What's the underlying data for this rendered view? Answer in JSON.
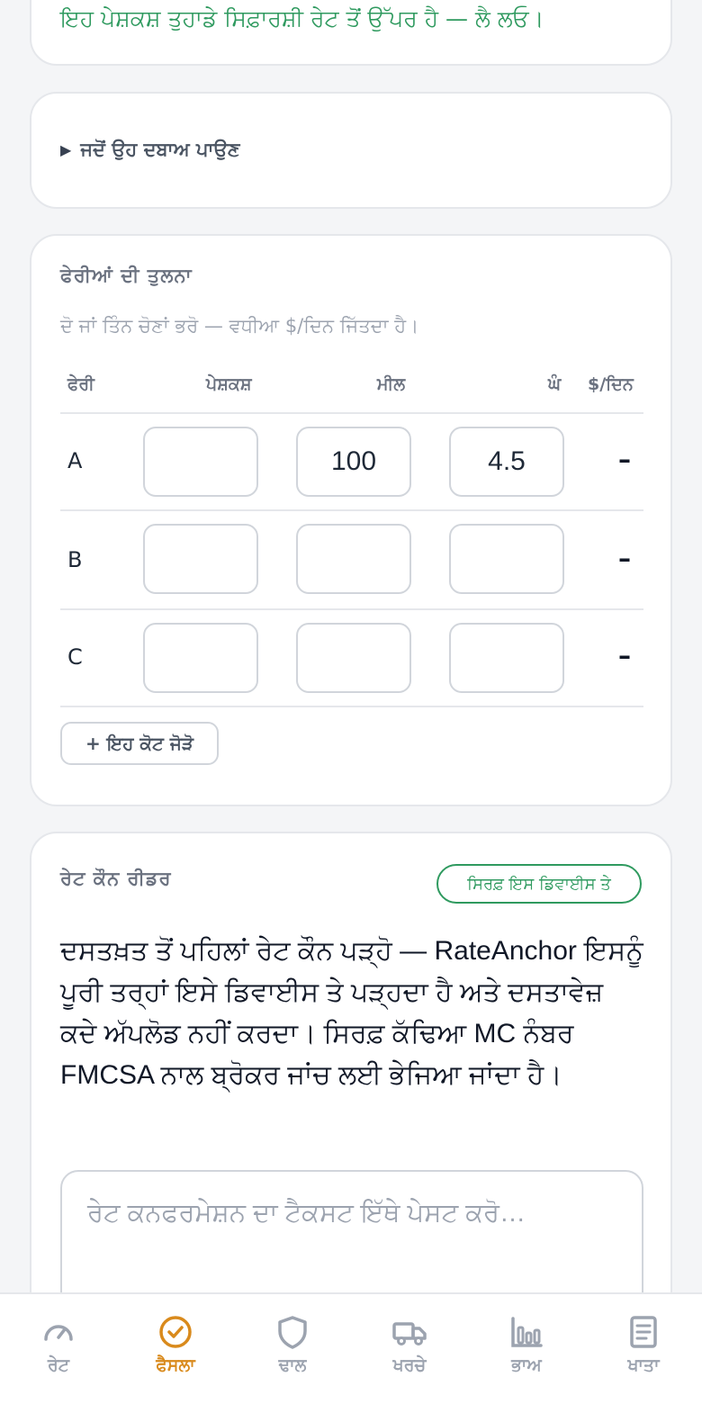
{
  "offer_verdict": {
    "accept_text": "ਇਹ ਪੇਸ਼ਕਸ਼ ਤੁਹਾਡੇ ਸਿਫ਼ਾਰਸ਼ੀ ਰੇਟ ਤੋਂ ਉੱਪਰ ਹੈ — ਲੈ ਲਓ।"
  },
  "pressure": {
    "label": "ਜਦੋਂ ਉਹ ਦਬਾਅ ਪਾਉਣ"
  },
  "compare": {
    "title": "ਫੇਰੀਆਂ ਦੀ ਤੁਲਨਾ",
    "subtitle": "ਦੋ ਜਾਂ ਤਿੰਨ ਚੋਣਾਂ ਭਰੋ — ਵਧੀਆ $/ਦਿਨ ਜਿੱਤਦਾ ਹੈ।",
    "headers": {
      "trip": "ਫੇਰੀ",
      "offer": "ਪੇਸ਼ਕਸ਼",
      "miles": "ਮੀਲ",
      "hours": "ਘੰ",
      "per_day": "$/ਦਿਨ"
    },
    "rows": [
      {
        "letter": "A",
        "offer": "",
        "miles": "100",
        "hours": "4.5",
        "per_day": "–"
      },
      {
        "letter": "B",
        "offer": "",
        "miles": "",
        "hours": "",
        "per_day": "–"
      },
      {
        "letter": "C",
        "offer": "",
        "miles": "",
        "hours": "",
        "per_day": "–"
      }
    ],
    "add_button": "+ ਇਹ ਕੋਟ ਜੋੜੋ"
  },
  "reader": {
    "title": "ਰੇਟ ਕੌਨ ਰੀਡਰ",
    "badge": "ਸਿਰਫ਼ ਇਸ ਡਿਵਾਈਸ ਤੇ",
    "body": "ਦਸਤਖ਼ਤ ਤੋਂ ਪਹਿਲਾਂ ਰੇਟ ਕੌਨ ਪੜ੍ਹੋ — RateAnchor ਇਸਨੂੰ ਪੂਰੀ ਤਰ੍ਹਾਂ ਇਸੇ ਡਿਵਾਈਸ ਤੇ ਪੜ੍ਹਦਾ ਹੈ ਅਤੇ ਦਸਤਾਵੇਜ਼ ਕਦੇ ਅੱਪਲੋਡ ਨਹੀਂ ਕਰਦਾ। ਸਿਰਫ਼ ਕੱਢਿਆ MC ਨੰਬਰ FMCSA ਨਾਲ ਬ੍ਰੋਕਰ ਜਾਂਚ ਲਈ ਭੇਜਿਆ ਜਾਂਦਾ ਹੈ।",
    "placeholder": "ਰੇਟ ਕਨਫਰਮੇਸ਼ਨ ਦਾ ਟੈਕਸਟ ਇੱਥੇ ਪੇਸਟ ਕਰੋ…"
  },
  "nav": {
    "items": [
      {
        "label": "ਰੇਟ",
        "icon": "gauge-icon"
      },
      {
        "label": "ਫੈਸਲਾ",
        "icon": "check-circle-icon",
        "active": true
      },
      {
        "label": "ਢਾਲ",
        "icon": "shield-icon"
      },
      {
        "label": "ਖਰਚੇ",
        "icon": "truck-icon"
      },
      {
        "label": "ਭਾਅ",
        "icon": "bar-chart-icon"
      },
      {
        "label": "ਖਾਤਾ",
        "icon": "document-icon"
      }
    ]
  },
  "colors": {
    "accent": "#d98a1c",
    "success": "#2f9a5f",
    "muted": "#9ca3af"
  }
}
